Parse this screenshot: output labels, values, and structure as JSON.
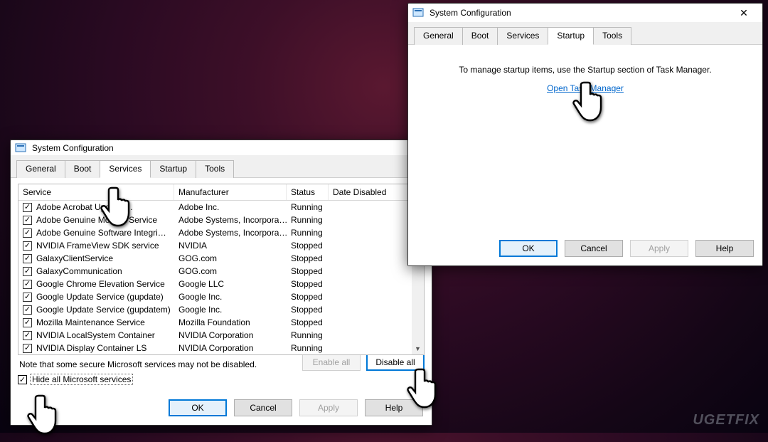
{
  "watermark": "UGETFIX",
  "window_services": {
    "title": "System Configuration",
    "tabs": [
      "General",
      "Boot",
      "Services",
      "Startup",
      "Tools"
    ],
    "active_tab": 2,
    "columns": {
      "service": "Service",
      "manufacturer": "Manufacturer",
      "status": "Status",
      "date_disabled": "Date Disabled"
    },
    "rows": [
      {
        "checked": true,
        "service": "Adobe Acrobat Update …",
        "manufacturer": "Adobe Inc.",
        "status": "Running"
      },
      {
        "checked": true,
        "service": "Adobe Genuine Monitor Service",
        "manufacturer": "Adobe Systems, Incorpora…",
        "status": "Running"
      },
      {
        "checked": true,
        "service": "Adobe Genuine Software Integri…",
        "manufacturer": "Adobe Systems, Incorpora…",
        "status": "Running"
      },
      {
        "checked": true,
        "service": "NVIDIA FrameView SDK service",
        "manufacturer": "NVIDIA",
        "status": "Stopped"
      },
      {
        "checked": true,
        "service": "GalaxyClientService",
        "manufacturer": "GOG.com",
        "status": "Stopped"
      },
      {
        "checked": true,
        "service": "GalaxyCommunication",
        "manufacturer": "GOG.com",
        "status": "Stopped"
      },
      {
        "checked": true,
        "service": "Google Chrome Elevation Service",
        "manufacturer": "Google LLC",
        "status": "Stopped"
      },
      {
        "checked": true,
        "service": "Google Update Service (gupdate)",
        "manufacturer": "Google Inc.",
        "status": "Stopped"
      },
      {
        "checked": true,
        "service": "Google Update Service (gupdatem)",
        "manufacturer": "Google Inc.",
        "status": "Stopped"
      },
      {
        "checked": true,
        "service": "Mozilla Maintenance Service",
        "manufacturer": "Mozilla Foundation",
        "status": "Stopped"
      },
      {
        "checked": true,
        "service": "NVIDIA LocalSystem Container",
        "manufacturer": "NVIDIA Corporation",
        "status": "Running"
      },
      {
        "checked": true,
        "service": "NVIDIA Display Container LS",
        "manufacturer": "NVIDIA Corporation",
        "status": "Running"
      }
    ],
    "note": "Note that some secure Microsoft services may not be disabled.",
    "enable_all": "Enable all",
    "disable_all": "Disable all",
    "hide_ms_checked": true,
    "hide_ms_label": "Hide all Microsoft services",
    "buttons": {
      "ok": "OK",
      "cancel": "Cancel",
      "apply": "Apply",
      "help": "Help"
    }
  },
  "window_startup": {
    "title": "System Configuration",
    "tabs": [
      "General",
      "Boot",
      "Services",
      "Startup",
      "Tools"
    ],
    "active_tab": 3,
    "message": "To manage startup items, use the Startup section of Task Manager.",
    "link_label": "Open Task Manager",
    "buttons": {
      "ok": "OK",
      "cancel": "Cancel",
      "apply": "Apply",
      "help": "Help"
    }
  }
}
